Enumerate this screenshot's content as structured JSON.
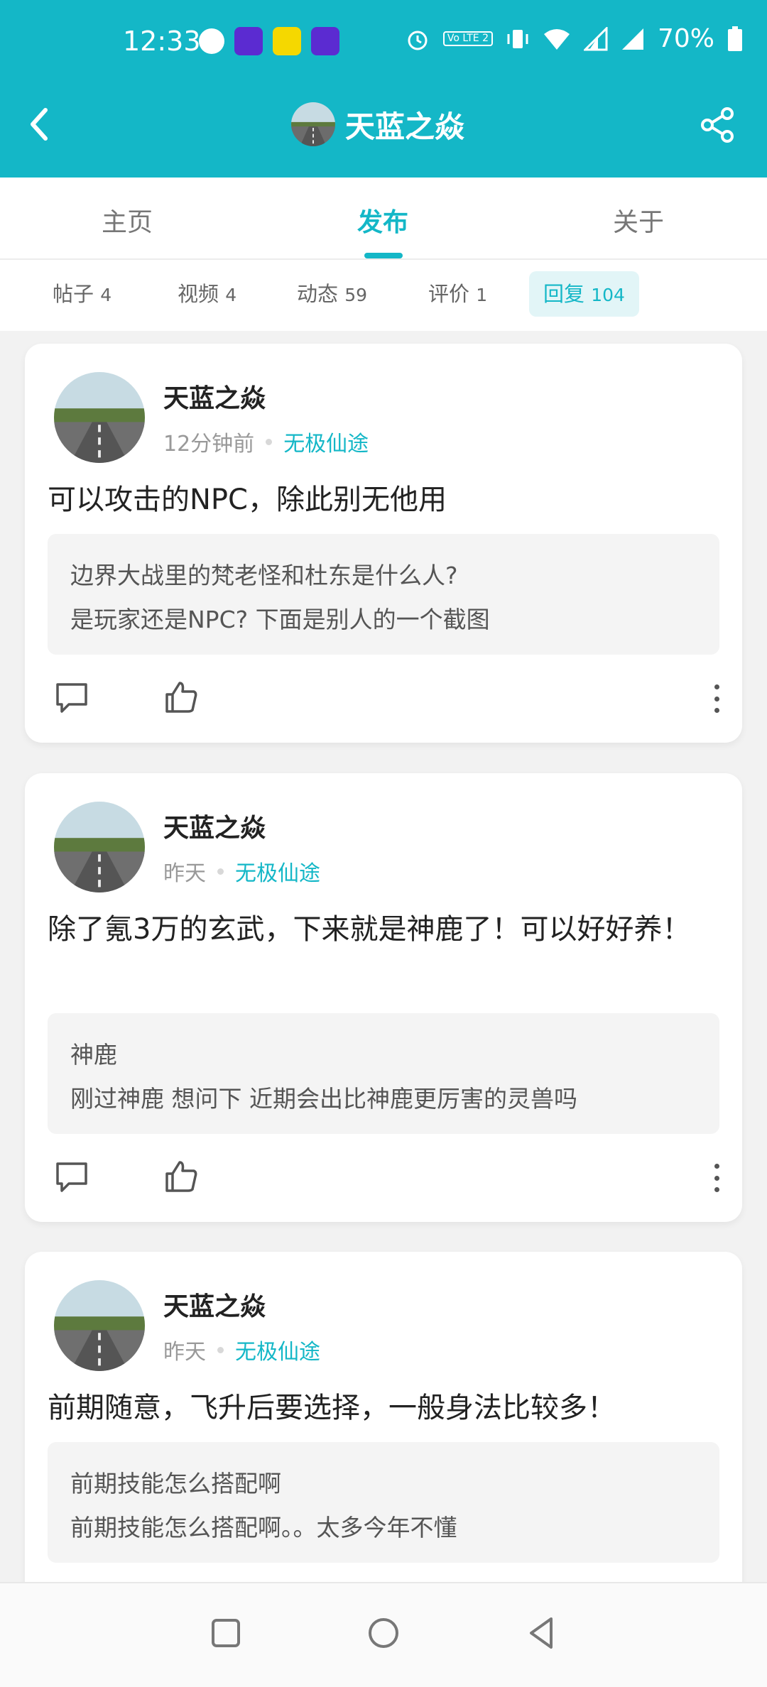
{
  "status_bar": {
    "time": "12:33",
    "battery": "70%",
    "volte": "Vo LTE 2"
  },
  "header": {
    "title": "天蓝之焱"
  },
  "tabs": [
    {
      "label": "主页"
    },
    {
      "label": "发布"
    },
    {
      "label": "关于"
    }
  ],
  "filters": [
    {
      "label": "帖子",
      "count": "4"
    },
    {
      "label": "视频",
      "count": "4"
    },
    {
      "label": "动态",
      "count": "59"
    },
    {
      "label": "评价",
      "count": "1"
    },
    {
      "label": "回复",
      "count": "104"
    }
  ],
  "posts": [
    {
      "author": "天蓝之焱",
      "time": "12分钟前",
      "game": "无极仙途",
      "content": "可以攻击的NPC，除此别无他用",
      "quote_line1": "边界大战里的梵老怪和杜东是什么人?",
      "quote_line2": "是玩家还是NPC? 下面是别人的一个截图"
    },
    {
      "author": "天蓝之焱",
      "time": "昨天",
      "game": "无极仙途",
      "content": "除了氪3万的玄武，下来就是神鹿了！可以好好养！",
      "quote_line1": "神鹿",
      "quote_line2": "刚过神鹿 想问下 近期会出比神鹿更厉害的灵兽吗"
    },
    {
      "author": "天蓝之焱",
      "time": "昨天",
      "game": "无极仙途",
      "content": "前期随意，飞升后要选择，一般身法比较多！",
      "quote_line1": "前期技能怎么搭配啊",
      "quote_line2": "前期技能怎么搭配啊。。太多今年不懂"
    }
  ],
  "colors": {
    "accent": "#14b7c7",
    "chip_bg": "#e2f5f7"
  },
  "icons": [
    "back-icon",
    "share-icon",
    "comment-icon",
    "like-icon",
    "more-icon",
    "recent-apps-icon",
    "home-icon",
    "back-nav-icon"
  ]
}
